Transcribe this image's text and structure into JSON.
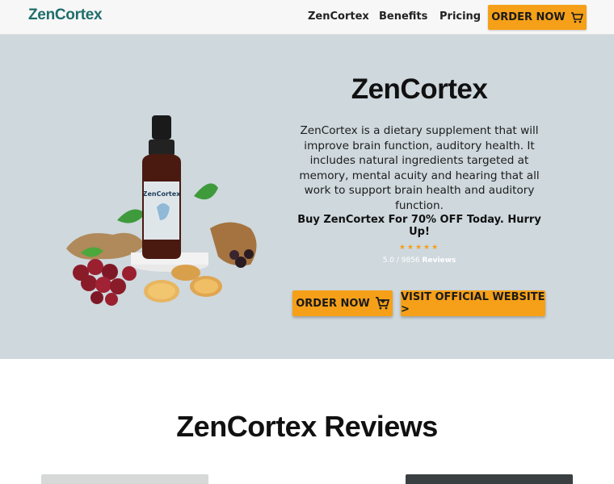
{
  "brand": {
    "logo_text": "ZenCortex"
  },
  "nav": {
    "links": [
      "ZenCortex",
      "Benefits",
      "Pricing"
    ],
    "order_label": "ORDER NOW"
  },
  "hero": {
    "title": "ZenCortex",
    "description": "ZenCortex is a dietary supplement that will improve brain function, auditory health. It includes natural ingredients targeted at memory, mental acuity and hearing that all work to support brain health and auditory function.",
    "offer": "Buy ZenCortex For 70% OFF Today. Hurry Up!",
    "stars": "★★★★★",
    "rating_score": "5.0 / 9856",
    "rating_label": "Reviews",
    "product_label": "ZenCortex",
    "order_button": "ORDER NOW",
    "visit_button": "VISIT OFFICIAL WEBSITE >"
  },
  "reviews": {
    "title": "ZenCortex Reviews"
  },
  "colors": {
    "accent": "#f5a018",
    "hero_bg": "#ced8dd",
    "logo": "#1f6d6b"
  },
  "icons": [
    "cart-icon"
  ]
}
